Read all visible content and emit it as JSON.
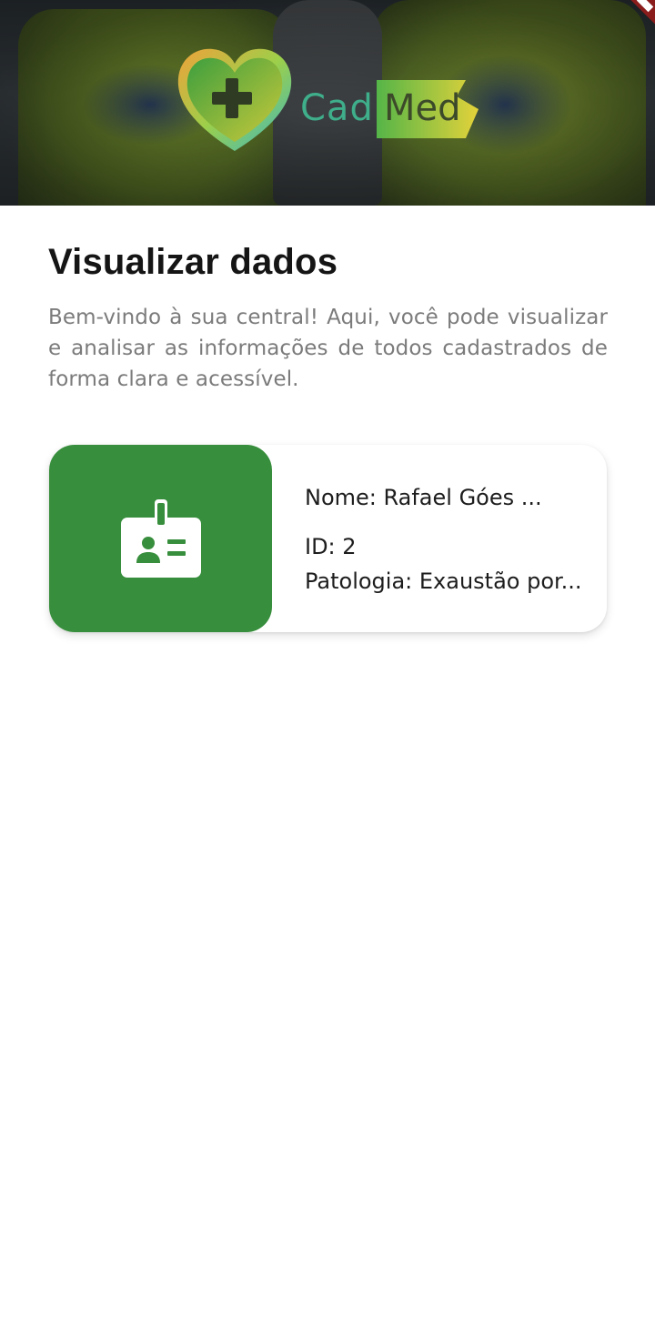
{
  "app": {
    "logo_text_cad": "Cad",
    "logo_text_med": "Med"
  },
  "page": {
    "title": "Visualizar dados",
    "description": "Bem-vindo à sua central! Aqui, você pode visualizar e analisar as informações de todos cadastrados de forma clara e acessível."
  },
  "records": [
    {
      "name": "Nome: Rafael Góes ...",
      "id": "ID: 2",
      "pathology": "Patologia: Exaustão por...",
      "icon": "id-badge-icon"
    }
  ],
  "colors": {
    "accent_green": "#378e3c",
    "title_text": "#151515",
    "description_text": "#7b7b7b"
  }
}
